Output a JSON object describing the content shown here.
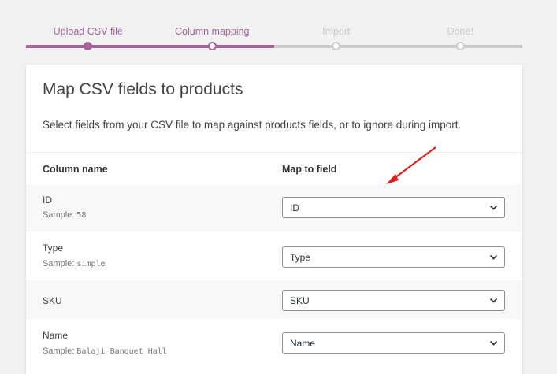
{
  "steps": [
    {
      "label": "Upload CSV file",
      "state": "done"
    },
    {
      "label": "Column mapping",
      "state": "active"
    },
    {
      "label": "Import",
      "state": "pending"
    },
    {
      "label": "Done!",
      "state": "pending"
    }
  ],
  "card": {
    "title": "Map CSV fields to products",
    "description": "Select fields from your CSV file to map against products fields, or to ignore during import."
  },
  "table": {
    "headers": {
      "column_name": "Column name",
      "map_to_field": "Map to field"
    },
    "rows": [
      {
        "name": "ID",
        "sample_label": "Sample:",
        "sample": "58",
        "mapped": "ID"
      },
      {
        "name": "Type",
        "sample_label": "Sample:",
        "sample": "simple",
        "mapped": "Type"
      },
      {
        "name": "SKU",
        "sample_label": "",
        "sample": "",
        "mapped": "SKU"
      },
      {
        "name": "Name",
        "sample_label": "Sample:",
        "sample": "Balaji Banquet Hall",
        "mapped": "Name"
      }
    ]
  },
  "colors": {
    "accent": "#a46497",
    "inactive": "#cccccc",
    "annotation_arrow": "#e02020"
  },
  "icons": {
    "select_chevron": "chevron-down-icon",
    "annotation": "red-arrow-icon"
  }
}
